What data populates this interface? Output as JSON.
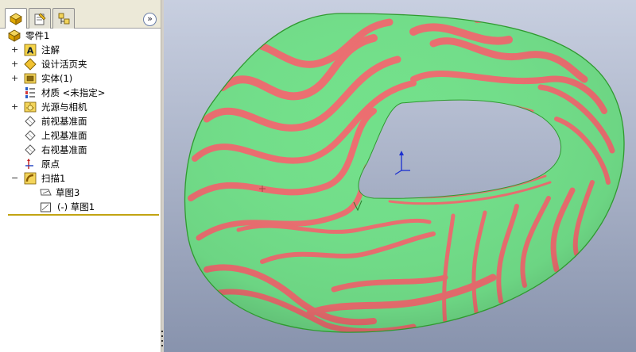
{
  "feature_manager": {
    "tabs": [
      {
        "name": "feature-tree-tab",
        "active": true
      },
      {
        "name": "property-manager-tab",
        "active": false
      },
      {
        "name": "configuration-manager-tab",
        "active": false
      }
    ],
    "expand_glyph": "»",
    "tree": [
      {
        "label": "零件1",
        "icon": "part-icon",
        "expander": ""
      },
      {
        "label": "注解",
        "icon": "annotations-icon",
        "expander": "+"
      },
      {
        "label": "设计活页夹",
        "icon": "design-binder-icon",
        "expander": "+"
      },
      {
        "label": "实体(1)",
        "icon": "solid-bodies-icon",
        "expander": "+"
      },
      {
        "label": "材质 <未指定>",
        "icon": "material-icon",
        "expander": ""
      },
      {
        "label": "光源与相机",
        "icon": "lights-cameras-icon",
        "expander": "+"
      },
      {
        "label": "前视基准面",
        "icon": "plane-icon",
        "expander": ""
      },
      {
        "label": "上视基准面",
        "icon": "plane-icon",
        "expander": ""
      },
      {
        "label": "右视基准面",
        "icon": "plane-icon",
        "expander": ""
      },
      {
        "label": "原点",
        "icon": "origin-icon",
        "expander": ""
      },
      {
        "label": "扫描1",
        "icon": "sweep-feature-icon",
        "expander": "−"
      },
      {
        "label": "草图3",
        "icon": "sketch-icon",
        "expander": ""
      },
      {
        "label": "(-) 草图1",
        "icon": "sketch-icon",
        "expander": ""
      }
    ]
  },
  "colors": {
    "stripe_green": "#72e08a",
    "stripe_red": "#ec6e70",
    "viewport_top": "#c8cfe0",
    "viewport_bottom": "#8893ad",
    "rollback_bar": "#c2a412"
  }
}
